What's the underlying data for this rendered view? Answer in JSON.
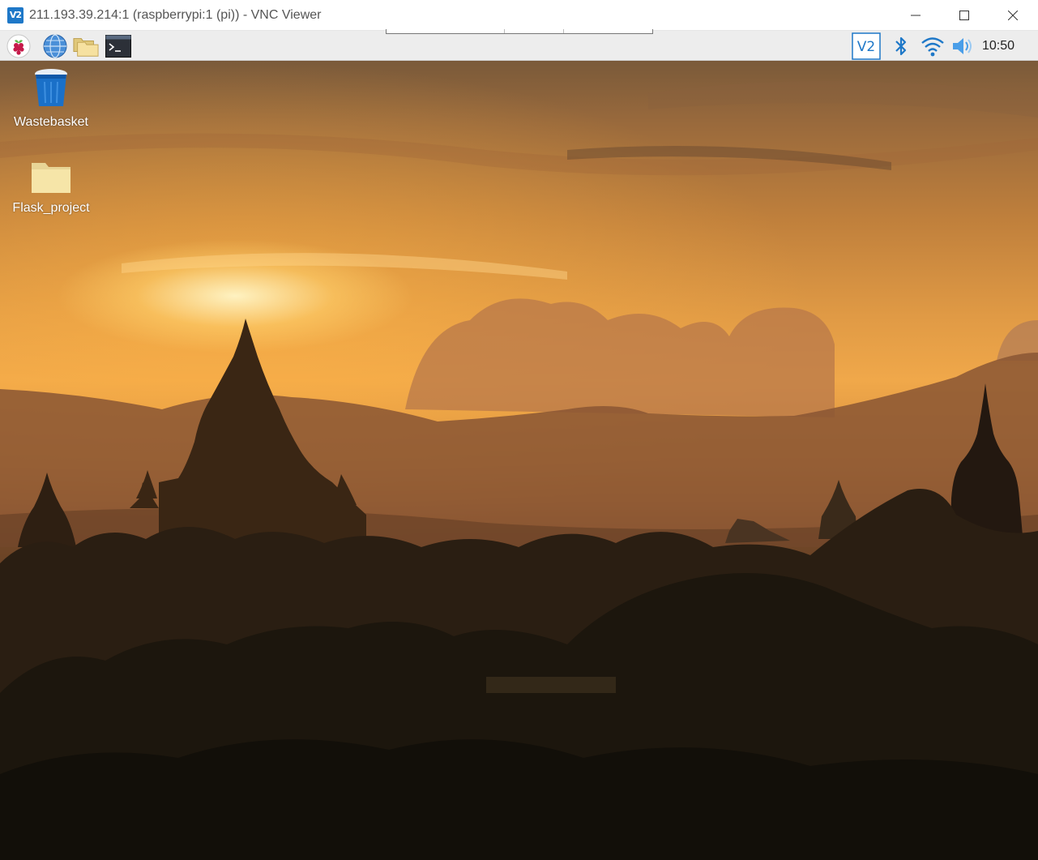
{
  "window": {
    "app_logo_text": "V2",
    "title": "211.193.39.214:1 (raspberrypi:1 (pi)) - VNC Viewer"
  },
  "panel": {
    "launchers": [
      "raspberry-menu",
      "web-browser",
      "file-manager",
      "terminal"
    ],
    "tray": [
      "vnc-server",
      "bluetooth",
      "wifi",
      "volume"
    ],
    "vnc_badge": "V2",
    "clock": "10:50"
  },
  "desktop": {
    "icons": [
      {
        "label": "Wastebasket",
        "icon": "trash-bin"
      },
      {
        "label": "Flask_project",
        "icon": "folder"
      }
    ]
  },
  "colors": {
    "accent": "#1e78c8",
    "panel_bg": "#ededed",
    "sky_glow": "#f0a84a"
  }
}
